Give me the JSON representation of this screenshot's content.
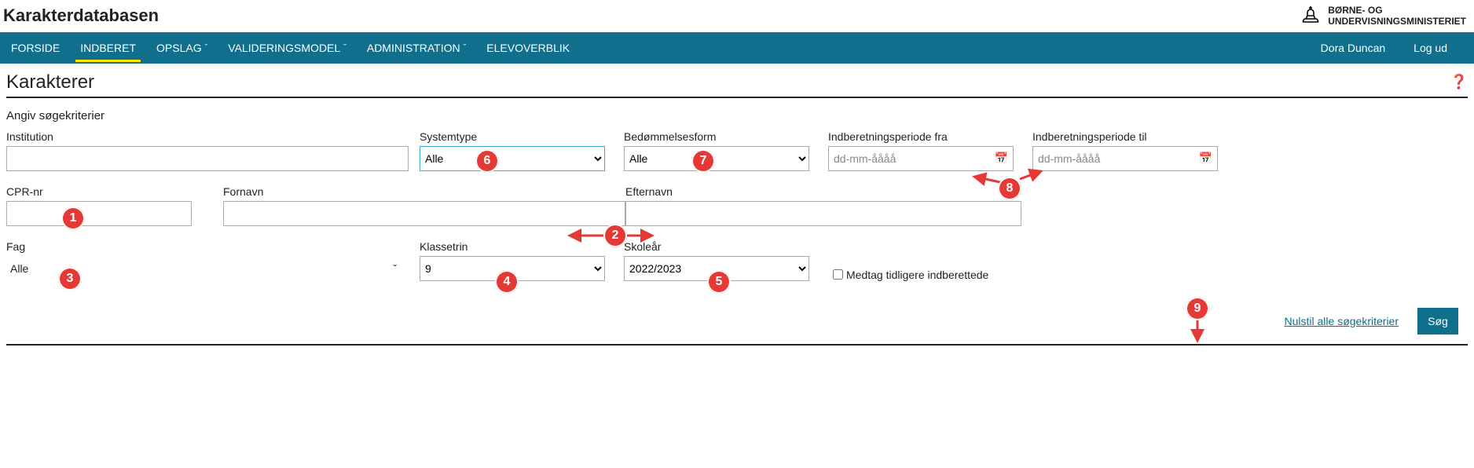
{
  "app": {
    "title": "Karakterdatabasen"
  },
  "ministry": {
    "line1": "BØRNE- OG",
    "line2": "UNDERVISNINGSMINISTERIET"
  },
  "nav": {
    "items": [
      {
        "label": "FORSIDE",
        "dropdown": false
      },
      {
        "label": "INDBERET",
        "dropdown": false,
        "active": true
      },
      {
        "label": "OPSLAG",
        "dropdown": true
      },
      {
        "label": "VALIDERINGSMODEL",
        "dropdown": true
      },
      {
        "label": "ADMINISTRATION",
        "dropdown": true
      },
      {
        "label": "ELEVOVERBLIK",
        "dropdown": false
      }
    ],
    "user": "Dora Duncan",
    "logout": "Log ud"
  },
  "page": {
    "title": "Karakterer",
    "section": "Angiv søgekriterier"
  },
  "fields": {
    "institution_label": "Institution",
    "systemtype_label": "Systemtype",
    "systemtype_value": "Alle",
    "bedform_label": "Bedømmelsesform",
    "bedform_value": "Alle",
    "periode_fra_label": "Indberetningsperiode fra",
    "periode_fra_placeholder": "dd-mm-åååå",
    "periode_til_label": "Indberetningsperiode til",
    "periode_til_placeholder": "dd-mm-åååå",
    "cpr_label": "CPR-nr",
    "fornavn_label": "Fornavn",
    "efternavn_label": "Efternavn",
    "fag_label": "Fag",
    "fag_value": "Alle",
    "klassetrin_label": "Klassetrin",
    "klassetrin_value": "9",
    "skoleaar_label": "Skoleår",
    "skoleaar_value": "2022/2023",
    "medtag_label": "Medtag tidligere indberettede"
  },
  "actions": {
    "reset": "Nulstil alle søgekriterier",
    "search": "Søg"
  },
  "annotations": {
    "b1": "1",
    "b2": "2",
    "b3": "3",
    "b4": "4",
    "b5": "5",
    "b6": "6",
    "b7": "7",
    "b8": "8",
    "b9": "9"
  }
}
